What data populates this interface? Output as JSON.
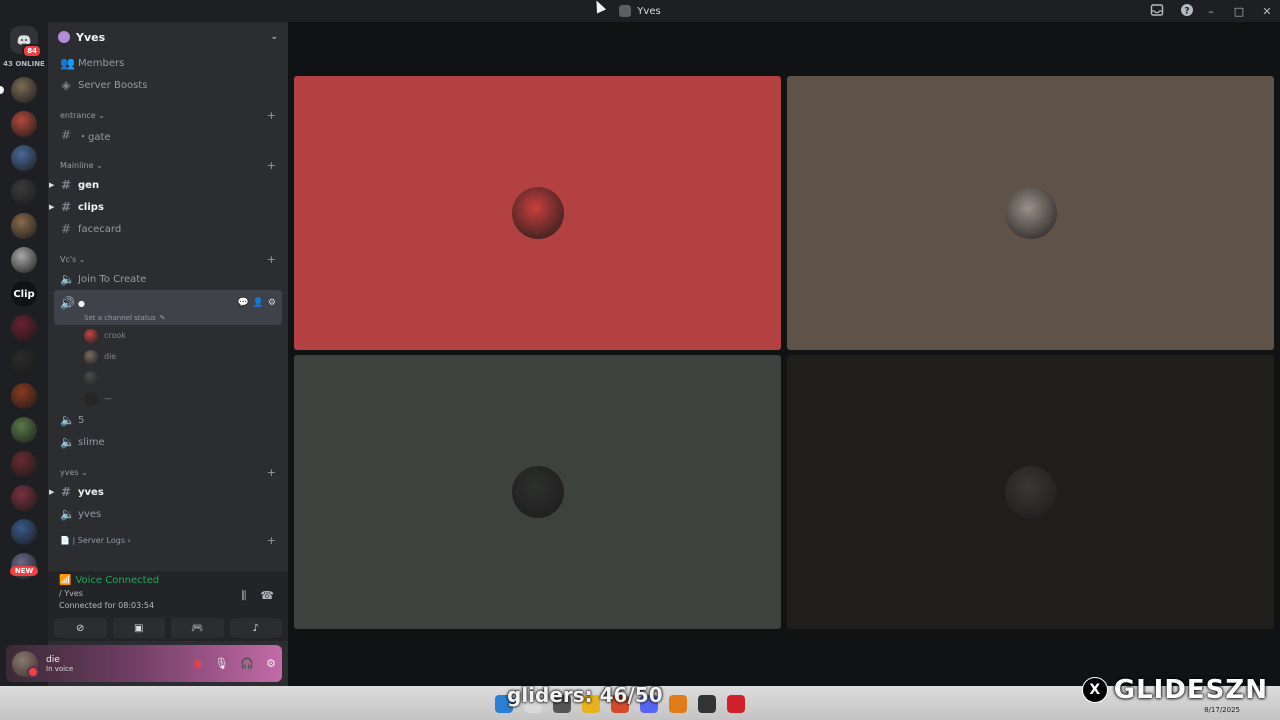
{
  "window": {
    "title": "Yves",
    "controls": [
      "–",
      "□",
      "✕"
    ]
  },
  "rail": {
    "home_badge": "84",
    "online_label": "43 ONLINE",
    "clip_label": "Clip",
    "new_label": "NEW",
    "servers": [
      {
        "color": "#7a6a55"
      },
      {
        "color": "#b24a3a"
      },
      {
        "color": "#4a6a9a"
      },
      {
        "color": "#3a3a3a"
      },
      {
        "color": "#8a6a4a"
      },
      {
        "color": "#a8a8a8"
      },
      {
        "color": "#111214",
        "clip": true
      },
      {
        "color": "#6a2030"
      },
      {
        "color": "#2a2a2a"
      },
      {
        "color": "#8a3a20"
      },
      {
        "color": "#5a7a4a"
      },
      {
        "color": "#6a2a30"
      },
      {
        "color": "#7a3040"
      },
      {
        "color": "#3a5a8a"
      },
      {
        "color": "#6a6a8a"
      }
    ]
  },
  "sidebar": {
    "server_name": "Yves",
    "top_items": [
      {
        "icon": "members-icon",
        "label": "Members"
      },
      {
        "icon": "boost-icon",
        "label": "Server Boosts"
      }
    ],
    "categories": {
      "entrance": "entrance",
      "mainline": "Mainline",
      "vcs": "Vc's",
      "yves": "yves",
      "logs": "| Server Logs"
    },
    "channels": {
      "gate": "・gate",
      "gen": "gen",
      "clips": "clips",
      "facecard": "facecard",
      "join_to_create": "Join To Create",
      "active_voice_status": "Set a channel status",
      "five": "5",
      "slime": "slime",
      "yves_text": "yves",
      "yves_voice": "yves"
    },
    "voice_users": [
      {
        "name": "crook",
        "color": "#c9403d"
      },
      {
        "name": "die",
        "color": "#7a6a60"
      },
      {
        "name": "",
        "color": "#4a4d4a"
      },
      {
        "name": "—",
        "color": "#2a2826"
      }
    ]
  },
  "voice_panel": {
    "status": "Voice Connected",
    "channel": "/ Yves",
    "connected_label": "Connected for 08:03:54"
  },
  "user": {
    "name": "die",
    "status": "In voice"
  },
  "stage": {
    "tiles": [
      {
        "bg": "#b34141",
        "pfp": "#c9403d"
      },
      {
        "bg": "#5e5249",
        "pfp": "#9a9088"
      },
      {
        "bg": "#3e423e",
        "pfp": "#2e302e"
      },
      {
        "bg": "#1f1e1b",
        "pfp": "#3a3836"
      }
    ]
  },
  "overlay": {
    "gliders": "gliders: 46/50",
    "brand": "GLIDESZN",
    "x_glyph": "X"
  },
  "taskbar": {
    "date": "8/17/2025",
    "apps": [
      "#2a7fd4",
      "#d9d9d9",
      "#555555",
      "#e7b21c",
      "#d04b2a",
      "#5865f2",
      "#e07b1a",
      "#333333",
      "#d0202a"
    ]
  }
}
